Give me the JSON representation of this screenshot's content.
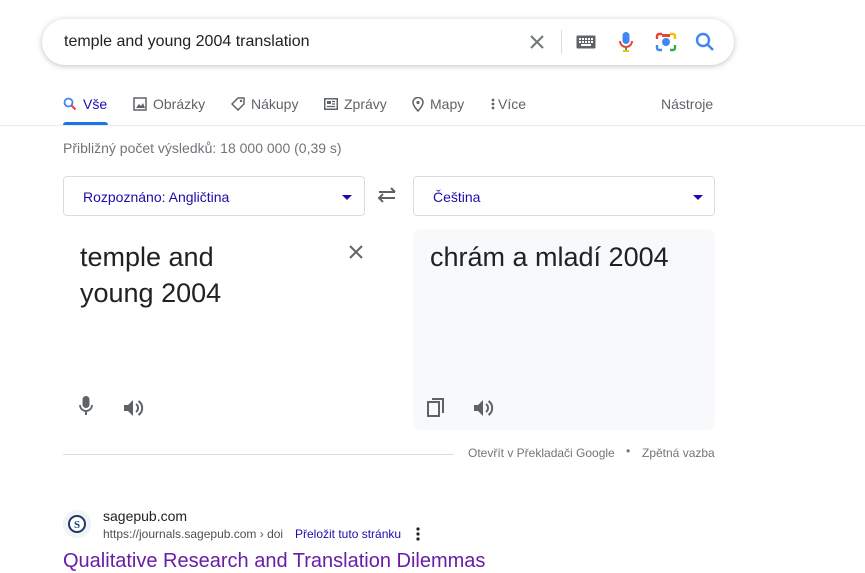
{
  "search": {
    "query": "temple and young 2004 translation"
  },
  "tabs": [
    {
      "label": "Vše",
      "icon": "search-icon",
      "active": true
    },
    {
      "label": "Obrázky",
      "icon": "image-icon"
    },
    {
      "label": "Nákupy",
      "icon": "tag-icon"
    },
    {
      "label": "Zprávy",
      "icon": "news-icon"
    },
    {
      "label": "Mapy",
      "icon": "map-pin-icon"
    },
    {
      "label": "Více",
      "icon": "more-vert-icon"
    }
  ],
  "tools_label": "Nástroje",
  "stats": "Přibližný počet výsledků: 18 000 000 (0,39 s)",
  "translator": {
    "source_lang": "Rozpoznáno: Angličtina",
    "target_lang": "Čeština",
    "source_line1": "temple and",
    "source_line2": "young 2004",
    "target_text": "chrám a mladí 2004",
    "open_link": "Otevřít v Překladači Google",
    "separator": "•",
    "feedback_link": "Zpětná vazba"
  },
  "result": {
    "site_name": "sagepub.com",
    "url": "https://journals.sagepub.com › doi",
    "translate_link": "Přeložit tuto stránku",
    "title": "Qualitative Research and Translation Dilemmas"
  },
  "colors": {
    "link_blue": "#1a0dab",
    "visited_purple": "#681da8",
    "accent_blue": "#1a73e8",
    "gray_text": "#70757a"
  }
}
